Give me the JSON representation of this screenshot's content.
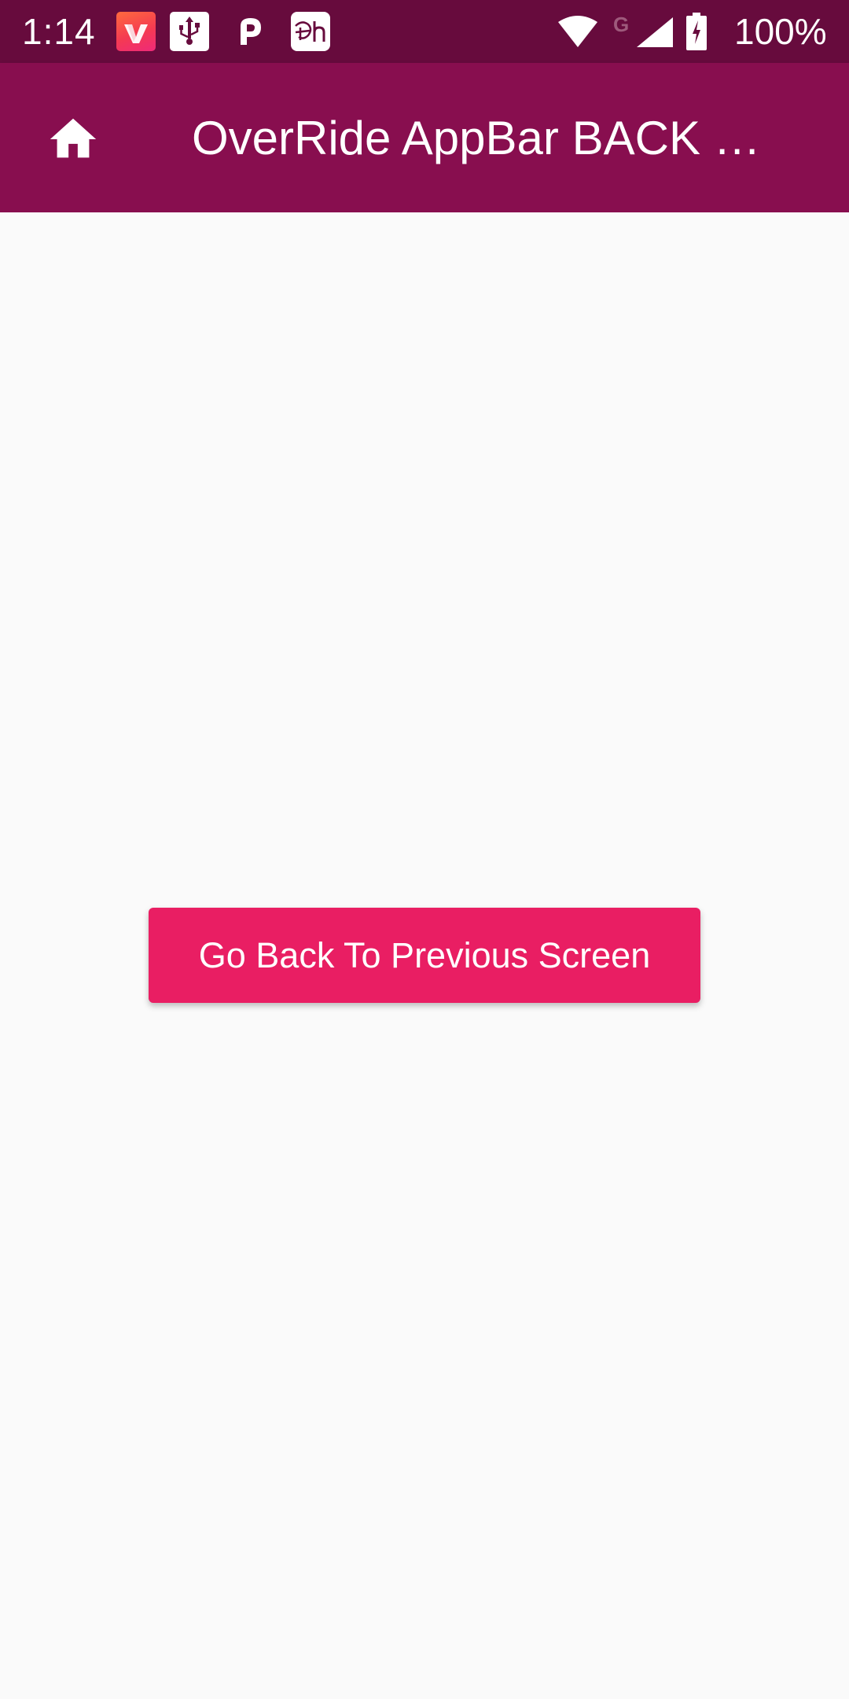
{
  "status_bar": {
    "time": "1:14",
    "notification_icons": [
      "vidmate-icon",
      "usb-icon",
      "p-app-icon",
      "disney-hotstar-icon"
    ],
    "network_type": "G",
    "battery_text": "100%",
    "colors": {
      "background": "#670b3d"
    }
  },
  "app_bar": {
    "leading_icon": "home-icon",
    "title": "OverRide AppBar BACK …",
    "colors": {
      "background": "#880e4f",
      "foreground": "#ffffff"
    }
  },
  "main": {
    "back_button_label": "Go Back To Previous Screen",
    "colors": {
      "button": "#e91e63",
      "background": "#fafafa"
    }
  }
}
